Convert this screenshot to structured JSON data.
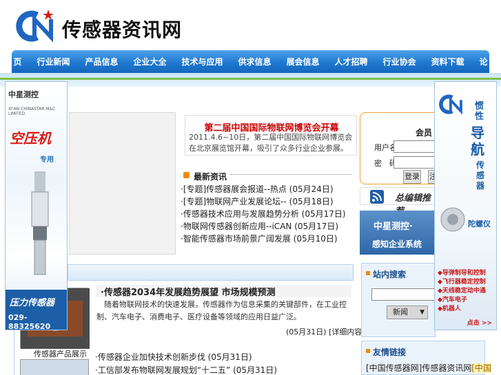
{
  "header": {
    "logo_letters": "CN",
    "logo_text": "传感器资讯网"
  },
  "nav": {
    "items": [
      "首 页",
      "行业新闻",
      "产品信息",
      "企业大全",
      "技术与应用",
      "供求信息",
      "展会信息",
      "人才招聘",
      "行业协会",
      "资料下载",
      "论 坛"
    ]
  },
  "ad_left": {
    "brand": "中星测控",
    "brand_sub": "XI'AN CHINASTAR M&C LIMITED",
    "title": "空压机",
    "title_sub": "专用",
    "band_title": "压力传感器",
    "phone": "029-88325620"
  },
  "ad_right": {
    "vertical_title": "导航",
    "small_title": "惯性",
    "suffix": "传感器",
    "gyro_label": "陀螺仪",
    "features": [
      "◆导弹制导和控制",
      "◆飞行器稳定控制",
      "◆天线稳定动中通",
      "◆汽车电子",
      "◆机器人"
    ],
    "more": "点击 >>"
  },
  "headline": {
    "title": "第二届中国国际物联网博览会开幕",
    "desc": "2011.4.6~10日，第二届中国国际物联网博览会在北京展览馆开幕，吸引了众多行业企业参展。"
  },
  "news": {
    "heading": "最新资讯",
    "items": [
      {
        "text": "·[专题]传感器展会报道--热点",
        "date": "(05月24日)"
      },
      {
        "text": "·[专题]物联网产业发展论坛--",
        "date": "(05月18日)"
      },
      {
        "text": "·传感器技术应用与发展趋势分析",
        "date": "(05月17日)"
      },
      {
        "text": "·物联网传感器创新应用--iCAN",
        "date": "(05月17日)"
      },
      {
        "text": "·智能传感器市场前景广阔发展",
        "date": "(05月10日)"
      }
    ]
  },
  "login": {
    "title": "会员登录",
    "user_label": "用户名：",
    "pass_label": "密　码：",
    "login_btn": "登录",
    "register_btn": "注册"
  },
  "rss": {
    "text": "总编辑推荐"
  },
  "banner": {
    "line1": "中星测控·",
    "line2": "感知企业系统"
  },
  "article": {
    "title": "·传感器2034年发展趋势展望 市场规模预测",
    "body": "　随着物联网技术的快速发展，传感器作为信息采集的关键部件，在工业控制、汽车电子、消费电子、医疗设备等领域的应用日益广泛。",
    "date": "(05月31日)",
    "more": "[详细内容]"
  },
  "photo": {
    "caption": "传感器产品展示"
  },
  "lower_list": [
    {
      "text": "·传感器企业加快技术创新步伐",
      "date": "(05月31日)"
    },
    {
      "text": "·工信部发布物联网发展规划“十二五”",
      "date": "(05月31日)"
    }
  ],
  "search": {
    "title": "站内搜索",
    "select_value": "新闻"
  },
  "friend": {
    "title": "友情链接",
    "text_a": "[中国传感器网]传感器资讯网",
    "text_b": "[中国"
  }
}
